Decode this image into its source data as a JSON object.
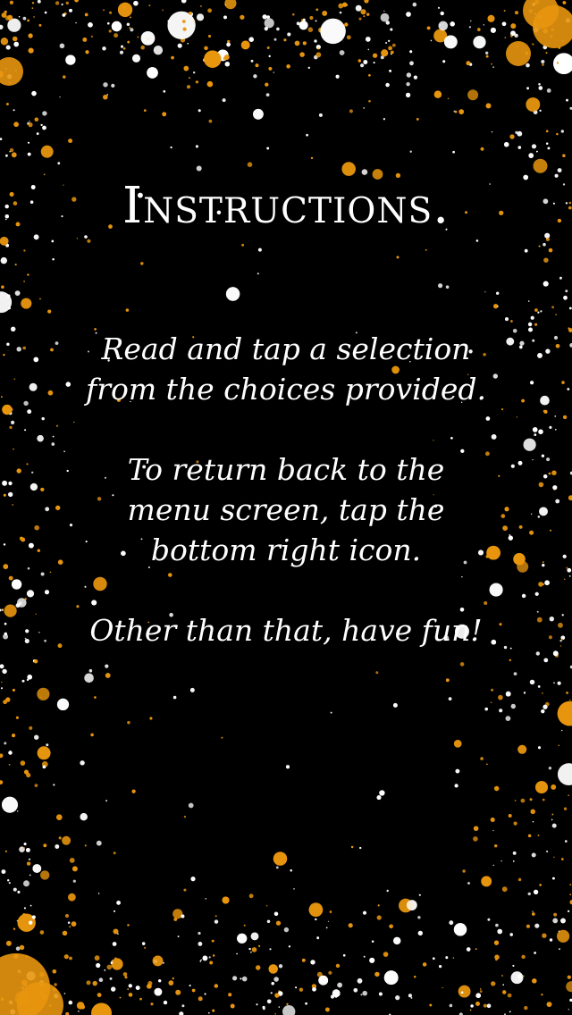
{
  "title": "Instructions.",
  "paragraphs": [
    {
      "lines": [
        "Read and tap a selection",
        "from the choices provided."
      ]
    },
    {
      "lines": [
        "To return back to the",
        "menu screen, tap the",
        "bottom right icon."
      ]
    },
    {
      "lines": [
        "Other than that, have fun!"
      ]
    }
  ],
  "colors": {
    "background": "#000000",
    "text": "#ffffff",
    "splatter_orange": "#e8960e",
    "splatter_white": "#ffffff"
  }
}
